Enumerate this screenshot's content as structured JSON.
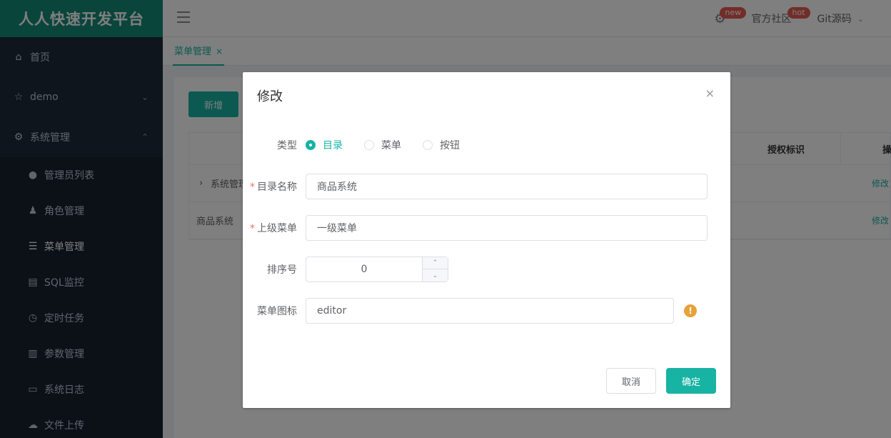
{
  "sidebar": {
    "brand": "人人快速开发平台",
    "items": [
      {
        "label": "首页",
        "icon": "home-icon"
      },
      {
        "label": "demo",
        "icon": "star-icon"
      },
      {
        "label": "系统管理",
        "icon": "gear-icon"
      }
    ],
    "sub_items": [
      {
        "label": "管理员列表",
        "icon": "user-icon"
      },
      {
        "label": "角色管理",
        "icon": "role-icon"
      },
      {
        "label": "菜单管理",
        "icon": "menu-list-icon"
      },
      {
        "label": "SQL监控",
        "icon": "sql-icon"
      },
      {
        "label": "定时任务",
        "icon": "clock-icon"
      },
      {
        "label": "参数管理",
        "icon": "params-icon"
      },
      {
        "label": "系统日志",
        "icon": "log-icon"
      },
      {
        "label": "文件上传",
        "icon": "upload-icon"
      }
    ]
  },
  "header": {
    "new_badge": "new",
    "community": "官方社区",
    "hot_badge": "hot",
    "git": "Git源码"
  },
  "tabs": {
    "active": "菜单管理",
    "close": "×"
  },
  "content": {
    "add_button": "新增",
    "table": {
      "header_perm": "授权标识",
      "header_partial": "操",
      "rows": [
        {
          "name": "系统管理",
          "action": "修改"
        },
        {
          "name": "商品系统",
          "action": "修改"
        }
      ]
    }
  },
  "dialog": {
    "title": "修改",
    "close": "×",
    "type_label": "类型",
    "type_options": [
      "目录",
      "菜单",
      "按钮"
    ],
    "type_selected": "目录",
    "name_label": "目录名称",
    "name_value": "商品系统",
    "parent_label": "上级菜单",
    "parent_value": "一级菜单",
    "order_label": "排序号",
    "order_value": "0",
    "icon_label": "菜单图标",
    "icon_value": "editor",
    "cancel": "取消",
    "confirm": "确定"
  },
  "colors": {
    "accent": "#17b3a3",
    "sidebar_bg": "#1d2a38",
    "brand_bg": "#158a78",
    "warning": "#e6a23c",
    "badge": "#e45b50"
  }
}
